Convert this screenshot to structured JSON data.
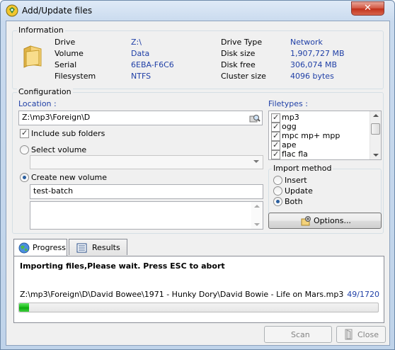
{
  "window": {
    "title": "Add/Update files",
    "close_symbol": "✕"
  },
  "information": {
    "group_label": "Information",
    "drive_label": "Drive",
    "drive_value": "Z:\\",
    "volume_label": "Volume",
    "volume_value": "Data",
    "serial_label": "Serial",
    "serial_value": "6EBA-F6C6",
    "filesystem_label": "Filesystem",
    "filesystem_value": "NTFS",
    "drive_type_label": "Drive Type",
    "drive_type_value": "Network",
    "disk_size_label": "Disk size",
    "disk_size_value": "1,907,727 MB",
    "disk_free_label": "Disk free",
    "disk_free_value": "306,074 MB",
    "cluster_size_label": "Cluster size",
    "cluster_size_value": "4096 bytes"
  },
  "configuration": {
    "group_label": "Configuration",
    "location_label": "Location :",
    "location_value": "Z:\\mp3\\Foreign\\D",
    "include_subfolders_label": "Include sub folders",
    "include_subfolders_checked": true,
    "select_volume_label": "Select volume",
    "select_volume_value": "",
    "create_volume_label": "Create new volume",
    "new_volume_name": "test-batch",
    "volume_mode": "create",
    "filetypes_label": "Filetypes :",
    "filetypes": [
      {
        "label": "mp3",
        "checked": true
      },
      {
        "label": "ogg",
        "checked": true
      },
      {
        "label": "mpc mp+ mpp",
        "checked": true
      },
      {
        "label": "ape",
        "checked": true
      },
      {
        "label": "flac fla",
        "checked": true
      }
    ],
    "import_method_label": "Import method",
    "import_options": [
      "Insert",
      "Update",
      "Both"
    ],
    "import_selected": "Both",
    "options_button": "Options..."
  },
  "tabs": [
    {
      "label": "Progress",
      "active": true
    },
    {
      "label": "Results",
      "active": false
    }
  ],
  "progress": {
    "status_text": "Importing files,Please wait. Press ESC to abort",
    "current_file": "Z:\\mp3\\Foreign\\D\\David Bowee\\1971 - Hunky Dory\\David Bowie - Life on Mars.mp3",
    "counter": "49/1720",
    "fraction": 0.0285
  },
  "buttons": {
    "scan": "Scan",
    "close": "Close"
  },
  "colors": {
    "value_text": "#1f3fa6",
    "progress_green": "#16b816",
    "close_red": "#c1301a"
  }
}
